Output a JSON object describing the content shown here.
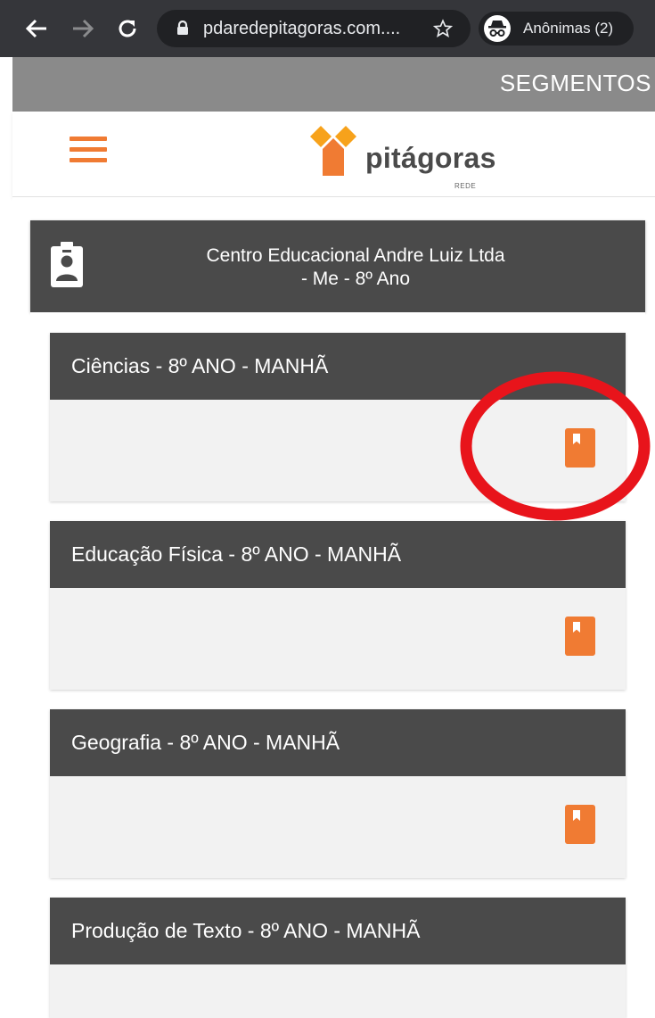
{
  "browser": {
    "url": "pdaredepitagoras.com....",
    "profile_label": "Anônimas (2)"
  },
  "segments": {
    "label": "SEGMENTOS"
  },
  "header": {
    "logo_text": "pitágoras",
    "logo_sub": "REDE",
    "accent_color": "#f07b33"
  },
  "school": {
    "line1": "Centro Educacional Andre Luiz Ltda",
    "line2": "- Me - 8º Ano"
  },
  "courses": [
    {
      "title": "Ciências - 8º ANO - MANHÃ"
    },
    {
      "title": "Educação Física - 8º ANO - MANHÃ"
    },
    {
      "title": "Geografia - 8º ANO - MANHÃ"
    },
    {
      "title": "Produção de Texto - 8º ANO - MANHÃ"
    }
  ],
  "icons": {
    "back": "arrow-left-icon",
    "forward": "arrow-right-icon",
    "reload": "reload-icon",
    "lock": "lock-icon",
    "star": "star-icon",
    "incognito": "incognito-icon",
    "menu": "hamburger-icon",
    "badge": "id-badge-icon",
    "book": "book-icon"
  },
  "annotation_color": "#e8141b"
}
